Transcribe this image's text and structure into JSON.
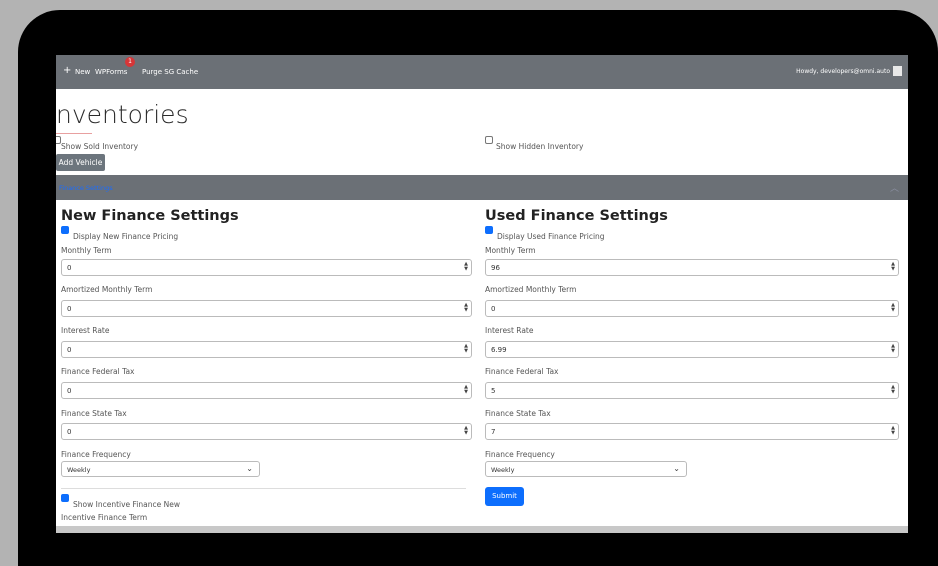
{
  "adminbar": {
    "new_label": "New",
    "wpforms_label": "WPForms",
    "badge_count": "1",
    "purge_label": "Purge SG Cache",
    "howdy": "Howdy, developers@omni.auto"
  },
  "page": {
    "title": "nventories",
    "show_sold_label": "Show Sold Inventory",
    "show_hidden_label": "Show Hidden Inventory",
    "add_vehicle_label": "Add Vehicle",
    "accordion_label": "Finance Settings"
  },
  "new_finance": {
    "heading": "New Finance Settings",
    "display_label": "Display New Finance Pricing",
    "monthly_term_label": "Monthly Term",
    "monthly_term": "0",
    "amortized_label": "Amortized Monthly Term",
    "amortized": "0",
    "interest_label": "Interest Rate",
    "interest": "0",
    "federal_label": "Finance Federal Tax",
    "federal": "0",
    "state_label": "Finance State Tax",
    "state": "0",
    "frequency_label": "Finance Frequency",
    "frequency": "Weekly",
    "incentive_label": "Show Incentive Finance New",
    "incentive_term_label": "Incentive Finance Term"
  },
  "used_finance": {
    "heading": "Used Finance Settings",
    "display_label": "Display Used Finance Pricing",
    "monthly_term_label": "Monthly Term",
    "monthly_term": "96",
    "amortized_label": "Amortized Monthly Term",
    "amortized": "0",
    "interest_label": "Interest Rate",
    "interest": "6.99",
    "federal_label": "Finance Federal Tax",
    "federal": "5",
    "state_label": "Finance State Tax",
    "state": "7",
    "frequency_label": "Finance Frequency",
    "frequency": "Weekly",
    "submit_label": "Submit"
  }
}
